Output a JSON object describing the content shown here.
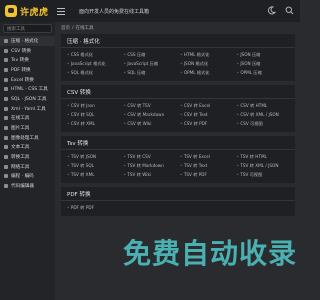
{
  "header": {
    "brand": "许虎虎",
    "tagline": "面向开发人员的免费在线工具箱"
  },
  "sidebar": {
    "search_placeholder": "搜索工具",
    "items": [
      {
        "label": "压缩 · 格式化"
      },
      {
        "label": "CSV 转换"
      },
      {
        "label": "Tsv 转换"
      },
      {
        "label": "PDF 转换"
      },
      {
        "label": "Excel 转换"
      },
      {
        "label": "HTML · CSS 工具"
      },
      {
        "label": "SQL · JSON 工具"
      },
      {
        "label": "Xml · Yaml 工具"
      },
      {
        "label": "在线工具"
      },
      {
        "label": "图片工具"
      },
      {
        "label": "图像处理工具"
      },
      {
        "label": "文本工具"
      },
      {
        "label": "转换工具"
      },
      {
        "label": "网络工具"
      },
      {
        "label": "编程 · 编码"
      },
      {
        "label": "代码编辑器"
      }
    ]
  },
  "breadcrumb": {
    "home": "首页",
    "sep": "/",
    "current": "在线工具"
  },
  "panels": [
    {
      "title": "压缩 · 格式化",
      "links": [
        "CSS 格式化",
        "CSS 压缩",
        "HTML 格式化",
        "JSON 压缩",
        "JavaScript 格式化",
        "JavaScript 压缩",
        "JSON 格式化",
        "JSON 压缩",
        "SQL 格式化",
        "SQL 压缩",
        "OPML 格式化",
        "OPML 压缩"
      ]
    },
    {
      "title": "CSV 转换",
      "links": [
        "CSV 转 Json",
        "CSV 转 TSV",
        "CSV 转 Excel",
        "CSV 转 HTML",
        "CSV 转 SQL",
        "CSV 转 Markdown",
        "CSV 转 Text",
        "CSV 转 XML / JSON",
        "CSV 转 XML",
        "CSV 转 Wiki",
        "CSV 转 PDF",
        "CSV 可视图"
      ]
    },
    {
      "title": "Tsv 转换",
      "links": [
        "TSV 转 JSON",
        "TSV 转 CSV",
        "TSV 转 Excel",
        "TSV 转 HTML",
        "TSV 转 SQL",
        "TSV 转 Markdown",
        "TSV 转 Text",
        "TSV 转 XML / JSON",
        "TSV 转 XML",
        "TSV 转 Wiki",
        "TSV 转 PDF",
        "TSV 可视图"
      ]
    },
    {
      "title": "PDF 转换",
      "links": [
        "PDF 转 PDF",
        "",
        "",
        ""
      ]
    }
  ],
  "watermark": {
    "text": "免费自动收录"
  },
  "colors": {
    "page_bg": "#2a2b2e",
    "panel_bg": "#1f2023",
    "brand": "#f2c230",
    "watermark": "#50c8c8"
  }
}
